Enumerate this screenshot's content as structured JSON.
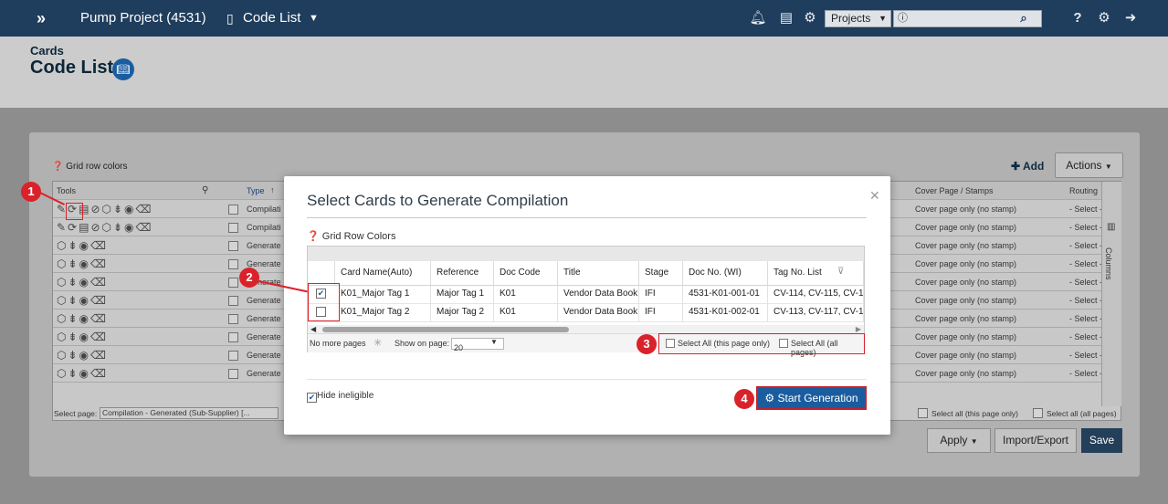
{
  "topbar": {
    "project": "Pump Project (4531)",
    "page": "Code List",
    "search_select": "Projects",
    "icons": [
      "bell-icon",
      "clock-report-icon",
      "gears-icon",
      "search-icon",
      "help-icon",
      "settings-icon",
      "logout-icon"
    ]
  },
  "header": {
    "crumb": "Cards",
    "title": "Code List"
  },
  "panel": {
    "grid_row_colors": "Grid row colors",
    "add_label": "Add",
    "actions_label": "Actions",
    "col_tools": "Tools",
    "col_type": "Type",
    "col_cover": "Cover Page / Stamps",
    "col_routing": "Routing",
    "columns_label": "Columns",
    "rows": [
      {
        "type": "Compilati",
        "cover": "Cover page only (no stamp)",
        "routing": "- Select -"
      },
      {
        "type": "Compilati",
        "cover": "Cover page only (no stamp)",
        "routing": "- Select -"
      },
      {
        "type": "Generate",
        "cover": "Cover page only (no stamp)",
        "routing": "- Select -"
      },
      {
        "type": "Generate",
        "cover": "Cover page only (no stamp)",
        "routing": "- Select -"
      },
      {
        "type": "Generate",
        "cover": "Cover page only (no stamp)",
        "routing": "- Select -"
      },
      {
        "type": "Generate",
        "cover": "Cover page only (no stamp)",
        "routing": "- Select -"
      },
      {
        "type": "Generate",
        "cover": "Cover page only (no stamp)",
        "routing": "- Select -"
      },
      {
        "type": "Generate",
        "cover": "Cover page only (no stamp)",
        "routing": "- Select -"
      },
      {
        "type": "Generate",
        "cover": "Cover page only (no stamp)",
        "routing": "- Select -"
      },
      {
        "type": "Generate",
        "cover": "Cover page only (no stamp)",
        "routing": "- Select -"
      }
    ],
    "select_page_label": "Select page:",
    "select_page_value": "Compilation - Generated (Sub-Supplier) [...",
    "select_all_page": "Select all (this page only)",
    "select_all_pages": "Select all (all pages)",
    "apply_label": "Apply",
    "import_label": "Import/Export",
    "save_label": "Save"
  },
  "modal": {
    "title": "Select Cards to Generate Compilation",
    "grid_row_colors": "Grid Row Colors",
    "columns": [
      "Card Name(Auto)",
      "Reference",
      "Doc Code",
      "Title",
      "Stage",
      "Doc No. (WI)",
      "Tag No. List"
    ],
    "rows": [
      {
        "checked": true,
        "card_name": "K01_Major Tag 1",
        "reference": "Major Tag 1",
        "doc_code": "K01",
        "title": "Vendor Data Book",
        "stage": "IFI",
        "doc_no": "4531-K01-001-01",
        "tags": "CV-114, CV-115, CV-11"
      },
      {
        "checked": false,
        "card_name": "K01_Major Tag 2",
        "reference": "Major Tag 2",
        "doc_code": "K01",
        "title": "Vendor Data Book",
        "stage": "IFI",
        "doc_no": "4531-K01-002-01",
        "tags": "CV-113, CV-117, CV-11"
      }
    ],
    "no_more_pages": "No more pages",
    "show_on_page_label": "Show on page:",
    "show_on_page_value": "20",
    "select_all_page": "Select All (this page only)",
    "select_all_pages": "Select All (all pages)",
    "hide_ineligible": "Hide ineligible",
    "start_generation": "Start Generation"
  },
  "callouts": [
    "1",
    "2",
    "3",
    "4"
  ]
}
